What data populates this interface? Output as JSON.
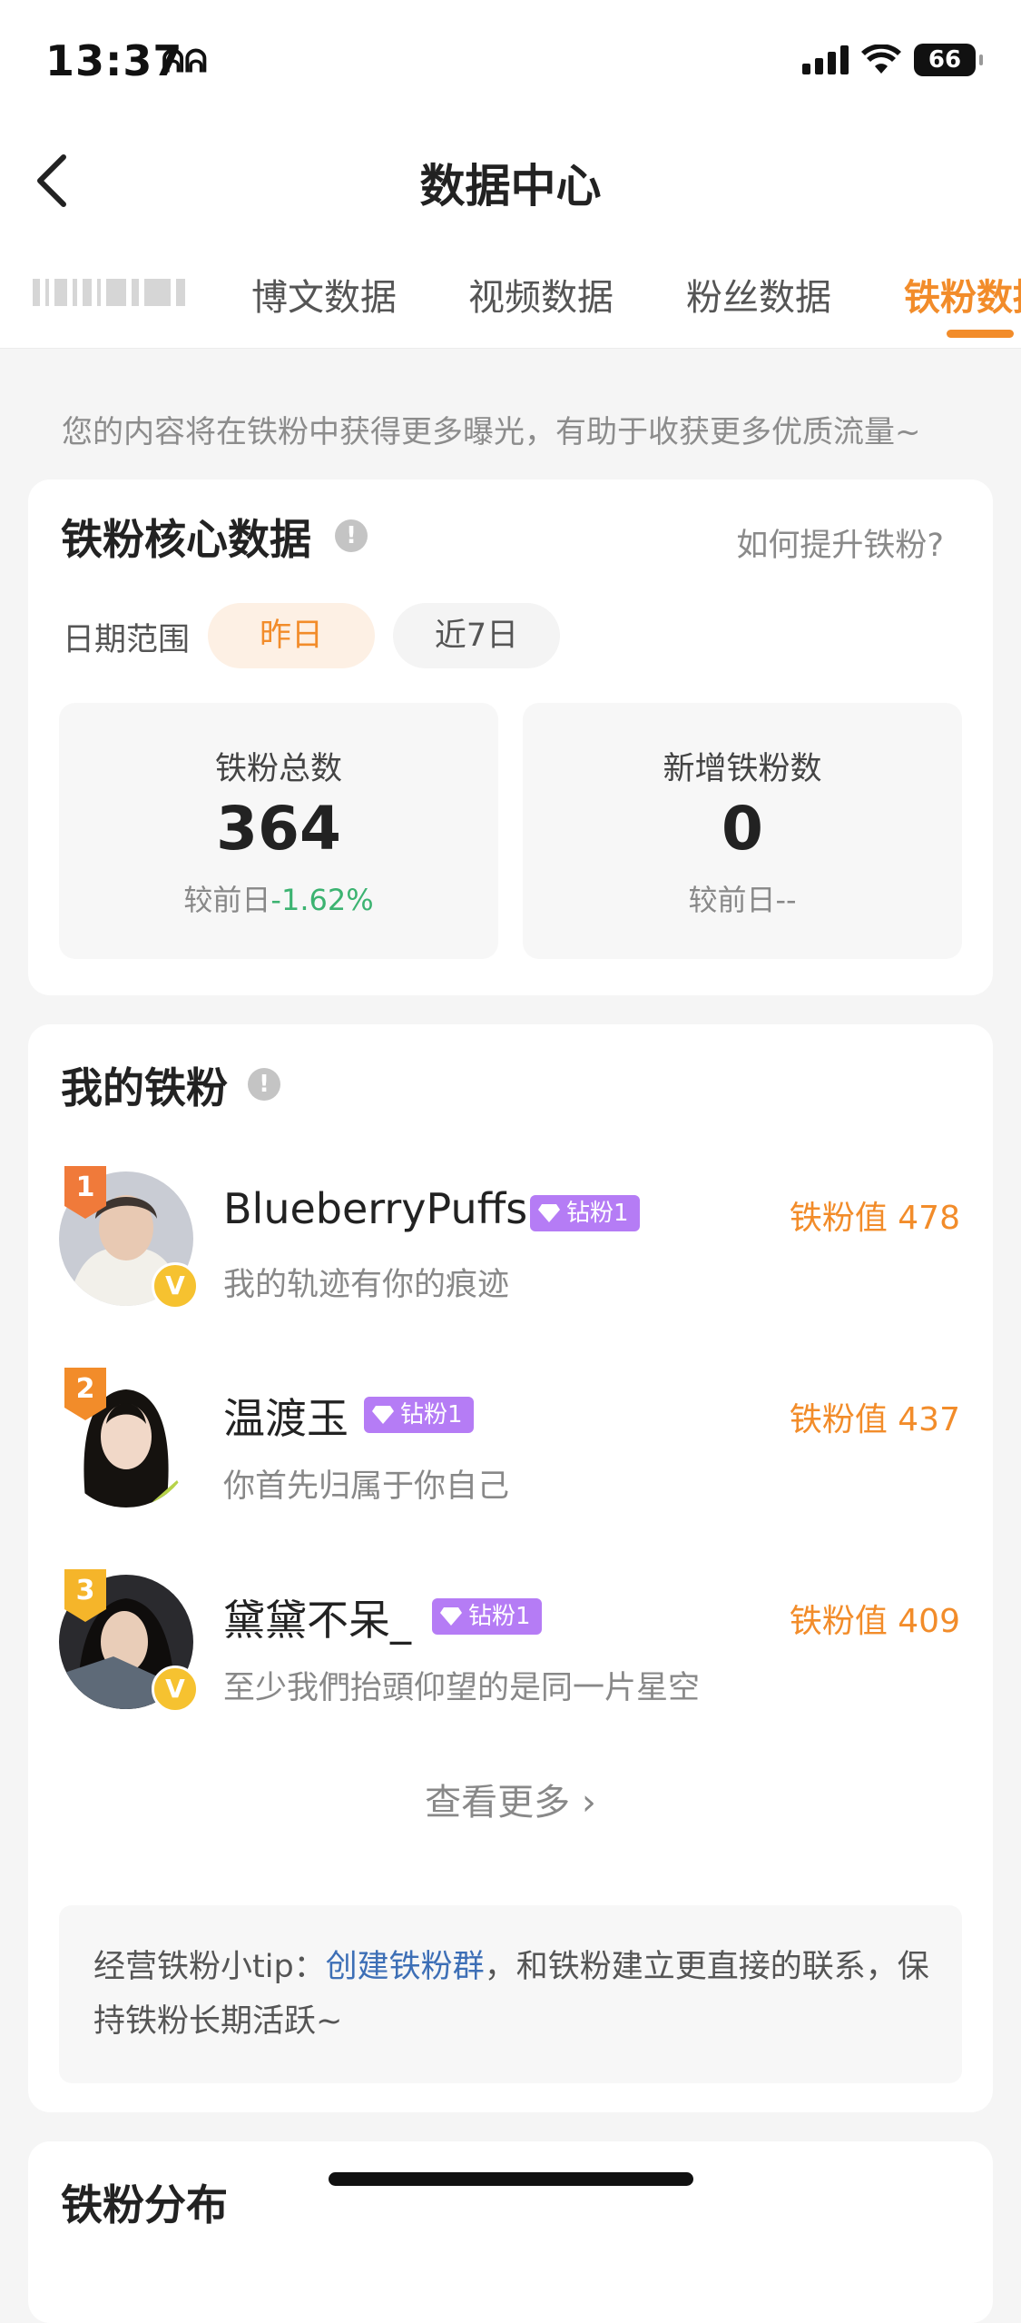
{
  "status_bar": {
    "time": "13:37",
    "extra": "ᕱᕱ",
    "battery": "66"
  },
  "nav": {
    "title": "数据中心"
  },
  "tabs": [
    {
      "label": "博文数据"
    },
    {
      "label": "视频数据"
    },
    {
      "label": "粉丝数据"
    },
    {
      "label": "铁粉数据"
    }
  ],
  "intro": "您的内容将在铁粉中获得更多曝光，有助于收获更多优质流量~",
  "core": {
    "title": "铁粉核心数据",
    "info_icon": "!",
    "help_link": "如何提升铁粉?",
    "date_label": "日期范围",
    "chips": [
      "昨日",
      "近7日"
    ],
    "stats": [
      {
        "label": "铁粉总数",
        "value": "364",
        "compare_prefix": "较前日",
        "compare_value": "-1.62%"
      },
      {
        "label": "新增铁粉数",
        "value": "0",
        "compare_prefix": "较前日",
        "compare_value": "--"
      }
    ]
  },
  "my_fans": {
    "title": "我的铁粉",
    "fans": [
      {
        "rank": "1",
        "name": "BlueberryPuffs",
        "badge": "钻粉1",
        "score": "铁粉值 478",
        "bio": "我的轨迹有你的痕迹",
        "verified": "V"
      },
      {
        "rank": "2",
        "name": "温渡玉",
        "badge": "钻粉1",
        "score": "铁粉值 437",
        "bio": "你首先归属于你自己",
        "verified": ""
      },
      {
        "rank": "3",
        "name": "黛黛不呆_",
        "badge": "钻粉1",
        "score": "铁粉值 409",
        "bio": "至少我們抬頭仰望的是同一片星空",
        "verified": "V"
      }
    ],
    "see_more": "查看更多 ›",
    "tip": {
      "prefix": "经营铁粉小tip：",
      "link": "创建铁粉群",
      "suffix": "，和铁粉建立更直接的联系，保持铁粉长期活跃~"
    }
  },
  "distribution": {
    "title": "铁粉分布"
  },
  "colors": {
    "accent": "#f28c2a",
    "badge_purple": "#b57cf5",
    "negative_delta": "#3cb371",
    "link": "#3d6fb6",
    "rank_1": "#f07a3a",
    "rank_2": "#f28c2a",
    "rank_3": "#f5b52a",
    "verified": "#f6c230"
  },
  "icons": {
    "back": "chevron-left-icon",
    "info": "info-icon",
    "diamond": "diamond-icon",
    "verified": "verified-badge-icon",
    "signal": "signal-icon",
    "wifi": "wifi-icon",
    "battery": "battery-icon"
  }
}
